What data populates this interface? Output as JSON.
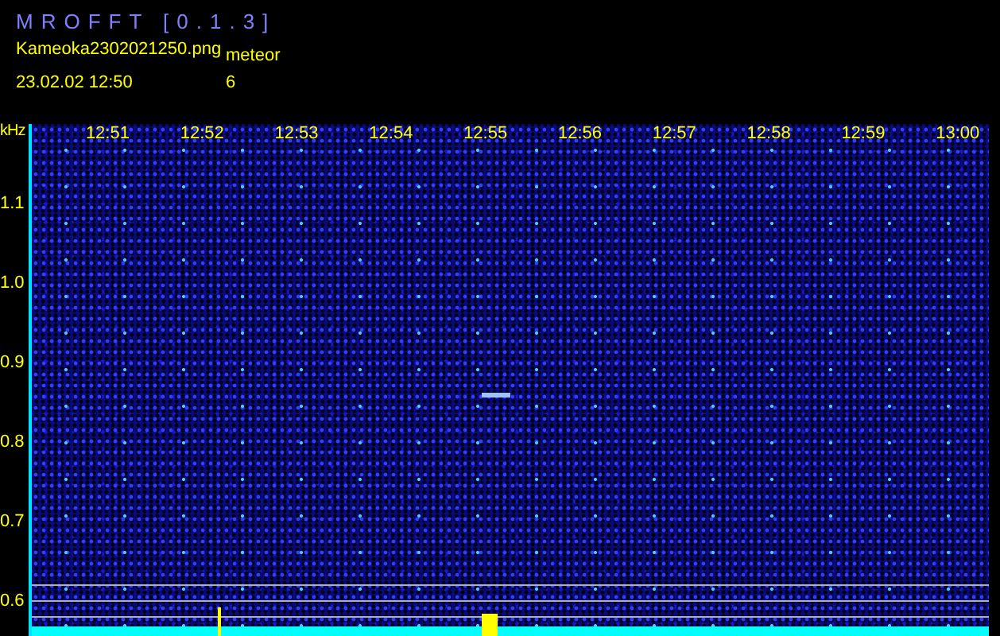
{
  "app": {
    "title": "MROFFT [0.1.3]"
  },
  "header": {
    "filename": "Kameoka2302021250.png",
    "category": "meteor",
    "timestamp": "23.02.02 12:50",
    "count": "6"
  },
  "frequency_axis": {
    "unit": "kHz",
    "labels": [
      "1.1",
      "1.0",
      "0.9",
      "0.8",
      "0.7",
      "0.6"
    ]
  },
  "time_axis": {
    "labels": [
      "12:51",
      "12:52",
      "12:53",
      "12:54",
      "12:55",
      "12:56",
      "12:57",
      "12:58",
      "12:59",
      "13:00"
    ]
  }
}
